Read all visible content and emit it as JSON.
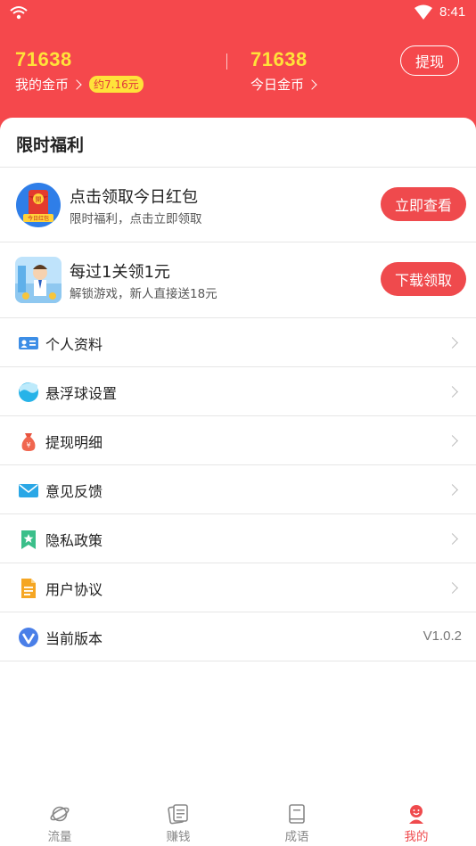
{
  "status_bar": {
    "time": "8:41"
  },
  "header": {
    "my_coins": {
      "value": "71638",
      "label": "我的金币",
      "badge": "约7.16元"
    },
    "today_coins": {
      "value": "71638",
      "label": "今日金币"
    },
    "withdraw_label": "提现",
    "color": "#f5484c"
  },
  "section": {
    "title": "限时福利"
  },
  "promos": [
    {
      "title": "点击领取今日红包",
      "subtitle": "限时福利，点击立即领取",
      "button": "立即查看",
      "icon": "red-envelope-icon",
      "thumb_text": "今日红包"
    },
    {
      "title": "每过1关领1元",
      "subtitle": "解锁游戏，新人直接送18元",
      "button": "下载领取",
      "icon": "game-character-icon"
    }
  ],
  "menu": [
    {
      "label": "个人资料",
      "icon": "id-card-icon"
    },
    {
      "label": "悬浮球设置",
      "icon": "floating-ball-icon"
    },
    {
      "label": "提现明细",
      "icon": "money-bag-icon"
    },
    {
      "label": "意见反馈",
      "icon": "envelope-icon"
    },
    {
      "label": "隐私政策",
      "icon": "bookmark-star-icon"
    },
    {
      "label": "用户协议",
      "icon": "document-icon"
    },
    {
      "label": "当前版本",
      "icon": "version-v-icon",
      "value": "V1.0.2"
    }
  ],
  "tabs": [
    {
      "label": "流量",
      "icon": "planet-icon",
      "active": false
    },
    {
      "label": "赚钱",
      "icon": "notes-icon",
      "active": false
    },
    {
      "label": "成语",
      "icon": "book-icon",
      "active": false
    },
    {
      "label": "我的",
      "icon": "profile-icon",
      "active": true
    }
  ],
  "colors": {
    "accent": "#ef4a4d",
    "coin_yellow": "#ffe23a"
  }
}
